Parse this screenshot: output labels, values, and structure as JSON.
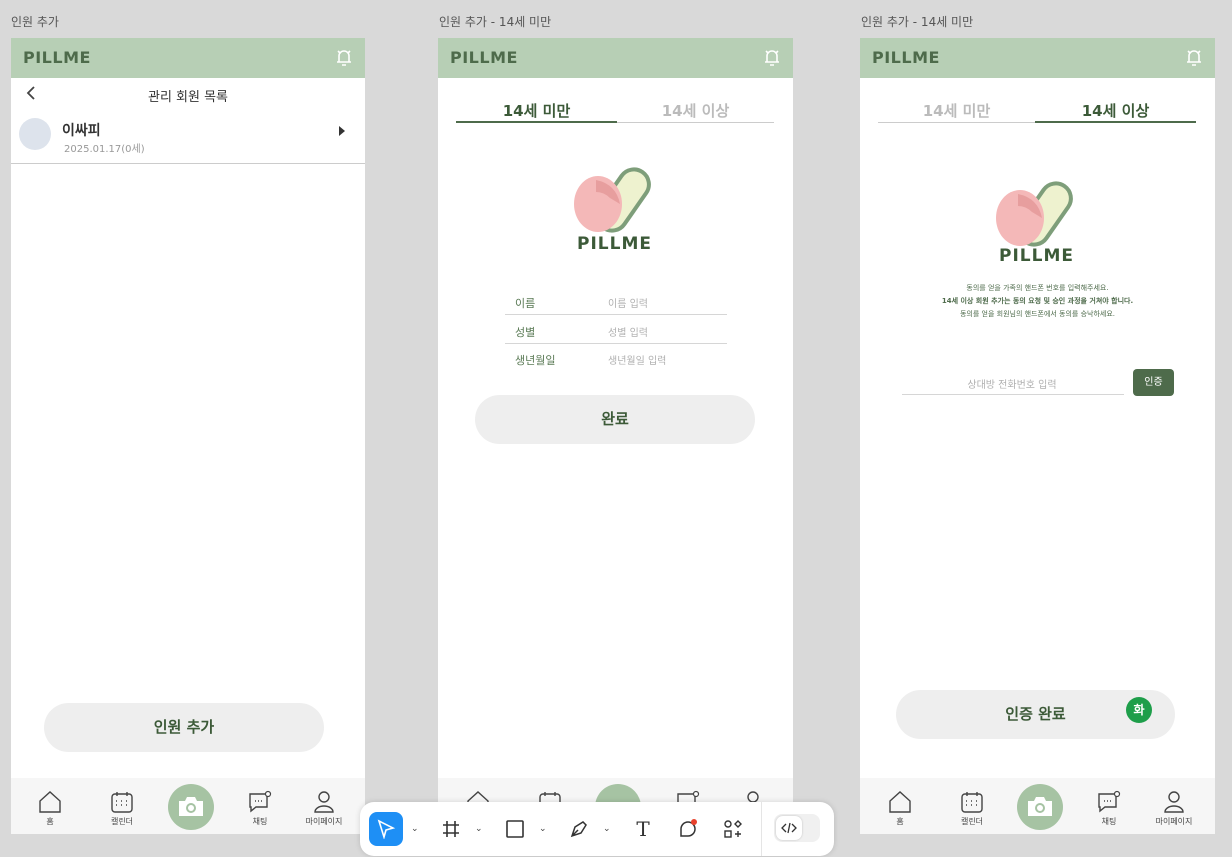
{
  "frames": [
    {
      "label": "인원 추가",
      "logo": "PILLME",
      "header_title": "관리 회원 목록",
      "member": {
        "name": "이싸피",
        "info": "2025.01.17(0세)"
      },
      "button": "인원 추가"
    },
    {
      "label": "인원 추가 - 14세 미만",
      "logo": "PILLME",
      "tabs": [
        "14세 미만",
        "14세 이상"
      ],
      "logo_word": "PILLME",
      "fields": [
        {
          "label": "이름",
          "placeholder": "이름 입력"
        },
        {
          "label": "성별",
          "placeholder": "성별 입력"
        },
        {
          "label": "생년월일",
          "placeholder": "생년월일 입력"
        }
      ],
      "button": "완료"
    },
    {
      "label": "인원 추가 - 14세 미만",
      "logo": "PILLME",
      "tabs": [
        "14세 미만",
        "14세 이상"
      ],
      "logo_word": "PILLME",
      "notice": [
        "동의를 얻을 가족의 핸드폰 번호를 입력해주세요.",
        "14세 이상 회원 추가는 동의 요청 및 승인 과정을 거쳐야 합니다.",
        "동의를 얻을 회원님의 핸드폰에서 동의를 승낙하세요."
      ],
      "phone_placeholder": "상대방 전화번호 입력",
      "verify_button": "인증",
      "button": "인증 완료",
      "badge": "화"
    }
  ],
  "nav": [
    "홈",
    "캘린더",
    "채팅",
    "마이페이지"
  ],
  "colors": {
    "header": "#b7cfb5",
    "brand_dark": "#4e6b4b",
    "accent_badge": "#1e9e4a",
    "tool_active": "#1e8ff5"
  },
  "toolbar": {
    "icons": [
      "pointer-icon",
      "frame-icon",
      "rectangle-icon",
      "pen-icon",
      "text-icon",
      "comment-icon",
      "components-icon",
      "code-icon"
    ],
    "text_tool_glyph": "T"
  }
}
